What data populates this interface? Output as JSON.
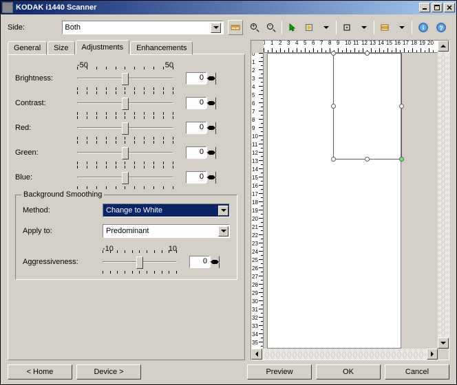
{
  "title": "KODAK i1440 Scanner",
  "side": {
    "label": "Side:",
    "value": "Both"
  },
  "tabs": {
    "general": "General",
    "size": "Size",
    "adjustments": "Adjustments",
    "enhancements": "Enhancements"
  },
  "scale": {
    "neg": "-50",
    "pos": "50"
  },
  "sliders": {
    "brightness": {
      "label": "Brightness:",
      "value": "0"
    },
    "contrast": {
      "label": "Contrast:",
      "value": "0"
    },
    "red": {
      "label": "Red:",
      "value": "0"
    },
    "green": {
      "label": "Green:",
      "value": "0"
    },
    "blue": {
      "label": "Blue:",
      "value": "0"
    }
  },
  "bg": {
    "title": "Background Smoothing",
    "method_label": "Method:",
    "method_value": "Change to White",
    "applyto_label": "Apply to:",
    "applyto_value": "Predominant",
    "scale_neg": "-10",
    "scale_pos": "10",
    "aggr_label": "Aggressiveness:",
    "aggr_value": "0"
  },
  "buttons": {
    "home": "< Home",
    "device": "Device >",
    "preview": "Preview",
    "ok": "OK",
    "cancel": "Cancel"
  },
  "ruler_h": [
    "0",
    "1",
    "2",
    "3",
    "4",
    "5",
    "6",
    "7",
    "8",
    "9",
    "10",
    "11",
    "12",
    "13",
    "14",
    "15",
    "16",
    "17",
    "18",
    "19",
    "20"
  ],
  "ruler_v": [
    "0",
    "1",
    "2",
    "3",
    "4",
    "5",
    "6",
    "7",
    "8",
    "9",
    "10",
    "11",
    "12",
    "13",
    "14",
    "15",
    "16",
    "17",
    "18",
    "19",
    "20",
    "21",
    "22",
    "23",
    "24",
    "25",
    "26",
    "27",
    "28",
    "29",
    "30",
    "31",
    "32",
    "33",
    "34",
    "35"
  ]
}
